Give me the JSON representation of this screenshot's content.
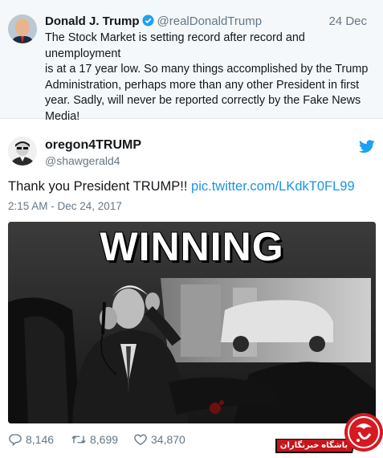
{
  "quoted_tweet": {
    "name": "Donald J. Trump",
    "handle": "@realDonaldTrump",
    "date": "24 Dec",
    "text": "The Stock Market is setting record after record and unemployment\nis at a 17 year low. So many things accomplished by the Trump\nAdministration, perhaps more than any other President in first\nyear. Sadly, will never be reported correctly by the Fake News\nMedia!"
  },
  "tweet": {
    "name": "oregon4TRUMP",
    "handle": "@shawgerald4",
    "text": "Thank you President TRUMP!! ",
    "link": "pic.twitter.com/LKdkT0FL99",
    "timestamp": "2:15 AM - Dec 24, 2017",
    "media_caption": "WINNING",
    "replies": "8,146",
    "retweets": "8,699",
    "likes": "34,870"
  },
  "watermark": {
    "label": "باشگاه خبرنگاران"
  },
  "colors": {
    "accent": "#1da1f2",
    "link": "#1b95e0",
    "secondary_text": "#657786",
    "badge_red": "#d71920"
  },
  "icons": [
    "verified-badge-icon",
    "twitter-bird-icon",
    "reply-icon",
    "retweet-icon",
    "like-icon"
  ]
}
